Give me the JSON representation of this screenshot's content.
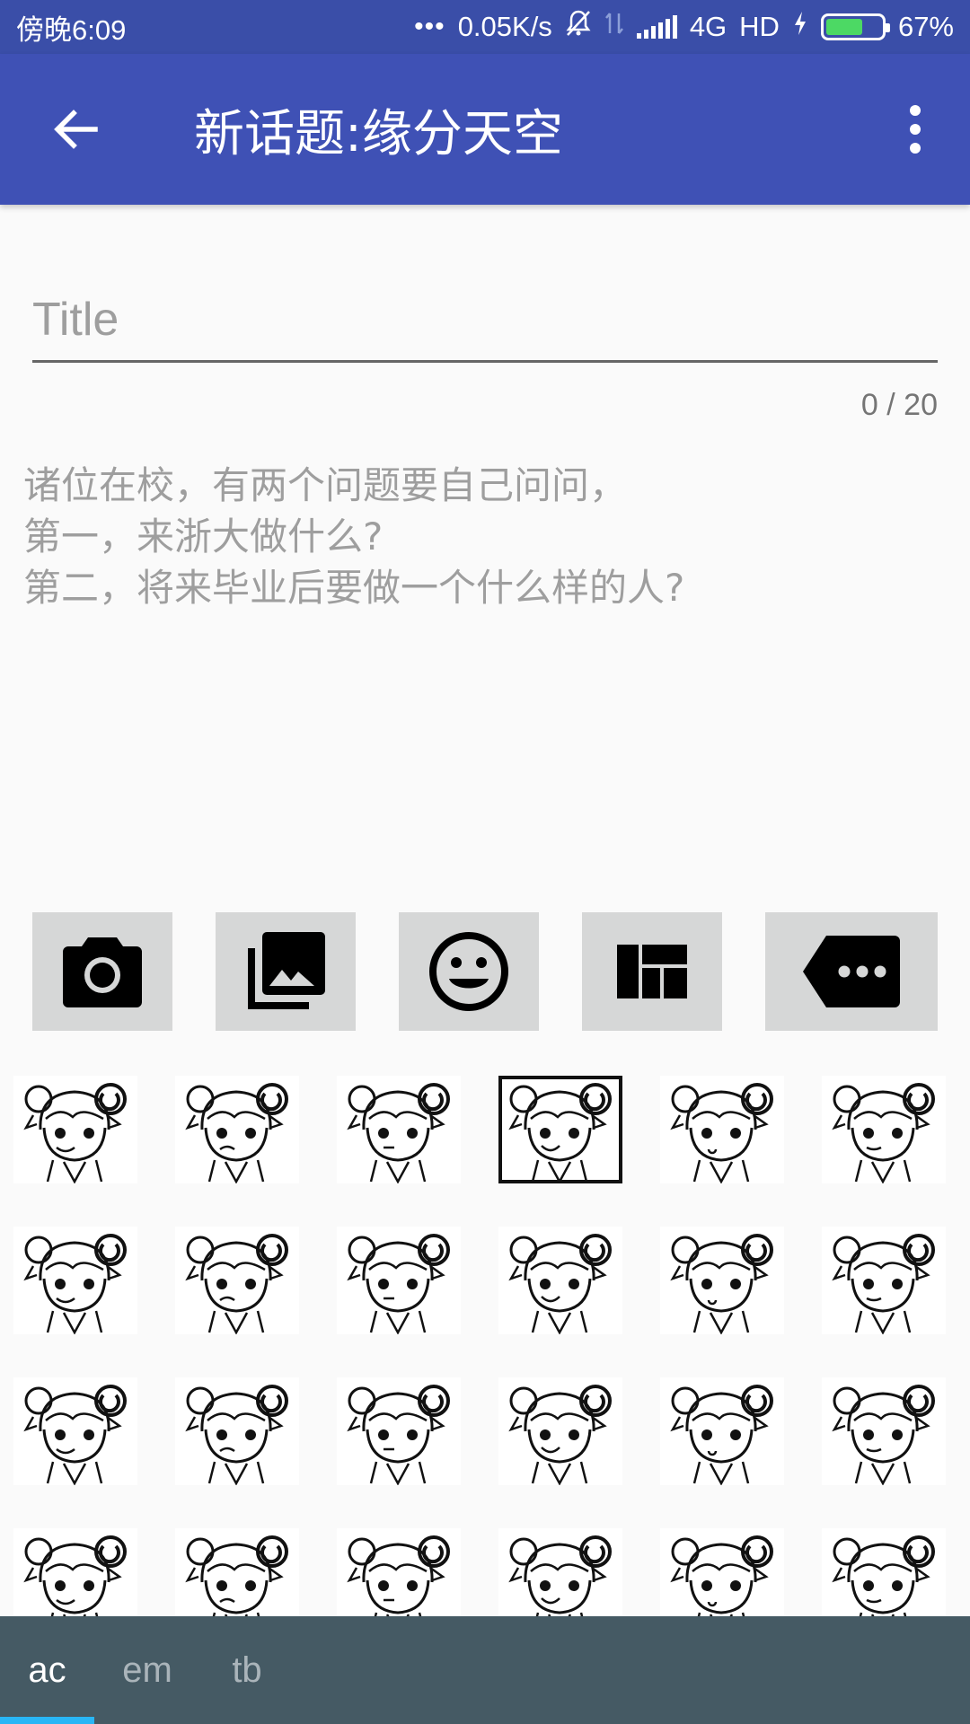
{
  "status_bar": {
    "time": "傍晚6:09",
    "net_speed": "0.05K/s",
    "network": "4G",
    "hd": "HD",
    "battery": "67%",
    "battery_level": 0.67
  },
  "app_bar": {
    "title": "新话题:缘分天空"
  },
  "form": {
    "title_placeholder": "Title",
    "title_counter": "0 / 20",
    "content_placeholder": "诸位在校，有两个问题要自己问问，\n第一，来浙大做什么?\n第二，将来毕业后要做一个什么样的人?"
  },
  "toolbar": {
    "buttons": [
      {
        "name": "camera",
        "icon": "camera-icon"
      },
      {
        "name": "gallery",
        "icon": "photo-library-icon"
      },
      {
        "name": "emoji",
        "icon": "smiley-icon"
      },
      {
        "name": "layout",
        "icon": "dashboard-icon"
      },
      {
        "name": "more",
        "icon": "more-tag-icon"
      }
    ]
  },
  "stickers": {
    "rows": 4,
    "cols": 6,
    "icon": "anime-girl-sticker-icon",
    "selected_index": 3
  },
  "bottom_tabs": {
    "items": [
      {
        "label": "ac",
        "active": true
      },
      {
        "label": "em",
        "active": false
      },
      {
        "label": "tb",
        "active": false
      }
    ],
    "indicator_color": "#29b6f6"
  },
  "colors": {
    "status_bar": "#3a4ea8",
    "app_bar": "#3f51b5",
    "toolbar_button_bg": "#d6d7d7",
    "bottom_bar": "#455a64",
    "battery_fill": "#4cd964"
  }
}
